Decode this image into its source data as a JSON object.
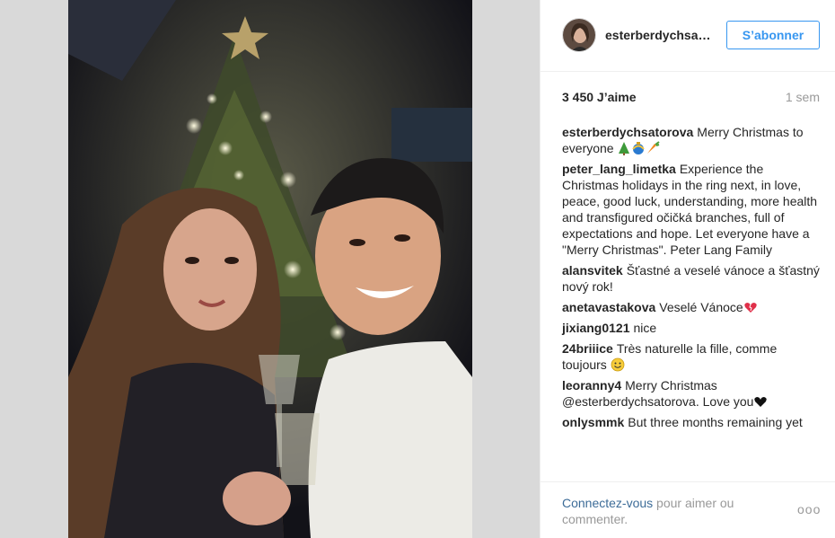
{
  "post": {
    "username": "esterberdychsa…",
    "follow_label": "S’abonner",
    "likes": "3 450 J’aime",
    "time_ago": "1 sem"
  },
  "comments": [
    {
      "user": "esterberdychsatorova",
      "text": "Merry Christmas to everyone",
      "emoji": [
        "tree-emoji",
        "decoration-emoji",
        "carrot-emoji"
      ]
    },
    {
      "user": "peter_lang_limetka",
      "text": "Experience the Christmas holidays in the ring next, in love, peace, good luck, understanding, more health and transfigured očičká branches, full of expectations and hope. Let everyone have a \"Merry Christmas\". Peter Lang Family"
    },
    {
      "user": "alansvitek",
      "text": "Šťastné a veselé vánoce a šťastný nový rok!"
    },
    {
      "user": "anetavastakova",
      "text": "Veselé Vánoce",
      "emoji": [
        "heart-emoji"
      ]
    },
    {
      "user": "jixiang0121",
      "text": "nice"
    },
    {
      "user": "24briiice",
      "text": "Très naturelle la fille, comme toujours",
      "emoji": [
        "smile-emoji"
      ]
    },
    {
      "user": "leoranny4",
      "text": "Merry Christmas @esterberdychsatorova. Love you",
      "emoji": [
        "black-heart-emoji"
      ]
    },
    {
      "user": "onlysmmk",
      "text": "But three months remaining yet"
    }
  ],
  "footer": {
    "login_link": "Connectez-vous",
    "login_rest": " pour aimer ou commenter.",
    "more_label": "ooo"
  },
  "colors": {
    "link": "#3d6c98",
    "follow": "#3897f0",
    "muted": "#999999"
  }
}
